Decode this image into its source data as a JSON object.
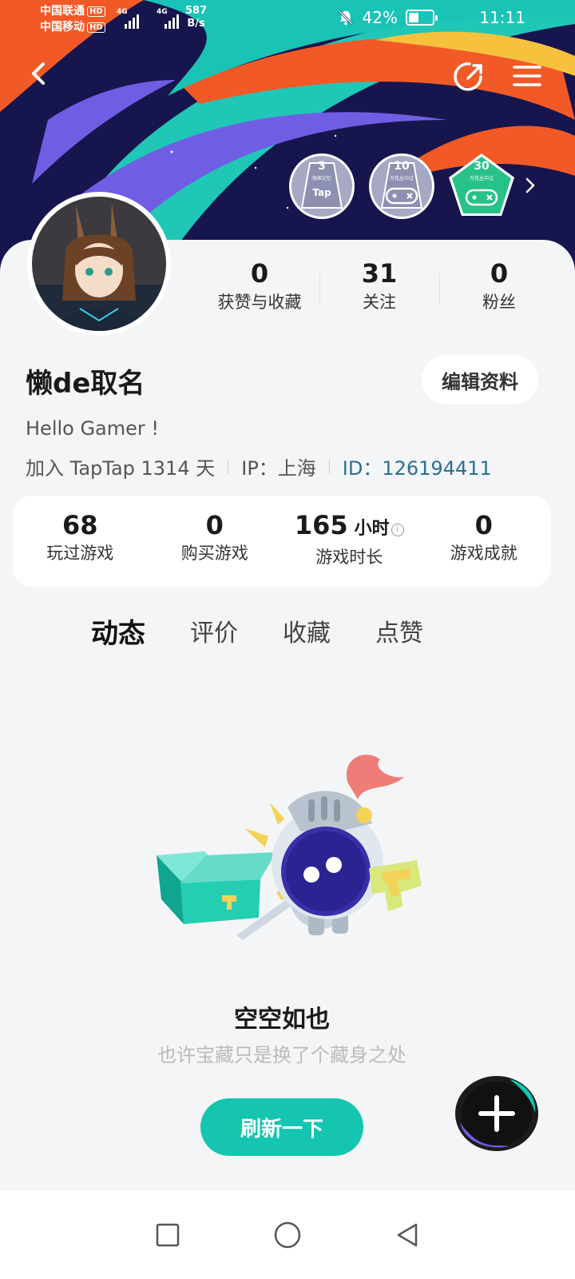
{
  "status_bar": {
    "carrier1": "中国联通",
    "carrier2": "中国移动",
    "hd": "HD",
    "net1": "4G",
    "net2": "4G",
    "speed_value": "587",
    "speed_unit": "B/s",
    "battery": "42%",
    "battery_level": 0.42,
    "time": "11:11"
  },
  "badges": [
    {
      "num": "3",
      "sub": "独家记忆",
      "label": "Tap",
      "color": "#a6a8c4"
    },
    {
      "num": "10",
      "sub": "万花丛中过",
      "label": "",
      "color": "#a6a8c4"
    },
    {
      "num": "30",
      "sub": "万花丛中过",
      "label": "",
      "color": "#27c28a"
    }
  ],
  "counts": [
    {
      "value": "0",
      "label": "获赞与收藏"
    },
    {
      "value": "31",
      "label": "关注"
    },
    {
      "value": "0",
      "label": "粉丝"
    }
  ],
  "profile": {
    "username": "懒de取名",
    "edit_label": "编辑资料",
    "bio": "Hello Gamer !",
    "joined": "加入 TapTap 1314 天",
    "ip": "IP：上海",
    "id": "ID：126194411"
  },
  "stats": [
    {
      "value": "68",
      "unit": "",
      "label": "玩过游戏"
    },
    {
      "value": "0",
      "unit": "",
      "label": "购买游戏"
    },
    {
      "value": "165",
      "unit": "小时",
      "label": "游戏时长"
    },
    {
      "value": "0",
      "unit": "",
      "label": "游戏成就"
    }
  ],
  "tabs": [
    "动态",
    "评价",
    "收藏",
    "点赞"
  ],
  "empty": {
    "title": "空空如也",
    "subtitle": "也许宝藏只是换了个藏身之处",
    "refresh_label": "刷新一下"
  },
  "colors": {
    "accent": "#15c5b0",
    "id_link": "#2a6f93",
    "banner_bg": "#14144a"
  }
}
